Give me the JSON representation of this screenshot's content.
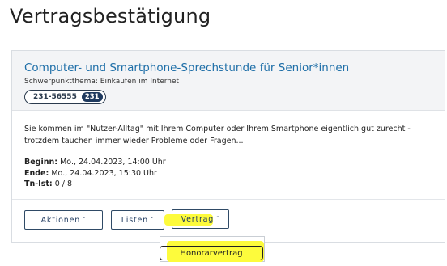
{
  "page": {
    "title": "Vertragsbestätigung"
  },
  "course": {
    "title": "Computer- und Smartphone-Sprechstunde für Senior*innen",
    "subtitle": "Schwerpunktthema: Einkaufen im Internet",
    "number": "231-56555",
    "badge": "231",
    "description": "Sie kommen im \"Nutzer-Alltag\" mit Ihrem Computer oder Ihrem Smartphone eigentlich gut zurecht - trotzdem tauchen immer wieder Probleme oder Fragen...",
    "begin_label": "Beginn:",
    "begin_value": " Mo., 24.04.2023, 14:00 Uhr",
    "end_label": "Ende:",
    "end_value": " Mo., 24.04.2023, 15:30 Uhr",
    "tn_label": "Tn-Ist:",
    "tn_value": " 0 / 8"
  },
  "buttons": {
    "aktionen": "Aktionen",
    "listen": "Listen",
    "vertrag": "Vertrag",
    "chevron": "˅"
  },
  "dropdown": {
    "items": [
      "Honorarvertrag"
    ]
  },
  "colors": {
    "link": "#1f6fa8",
    "button_border": "#2f4a66",
    "highlight": "#fdfb3c",
    "header_bg": "#f3f4f6"
  }
}
